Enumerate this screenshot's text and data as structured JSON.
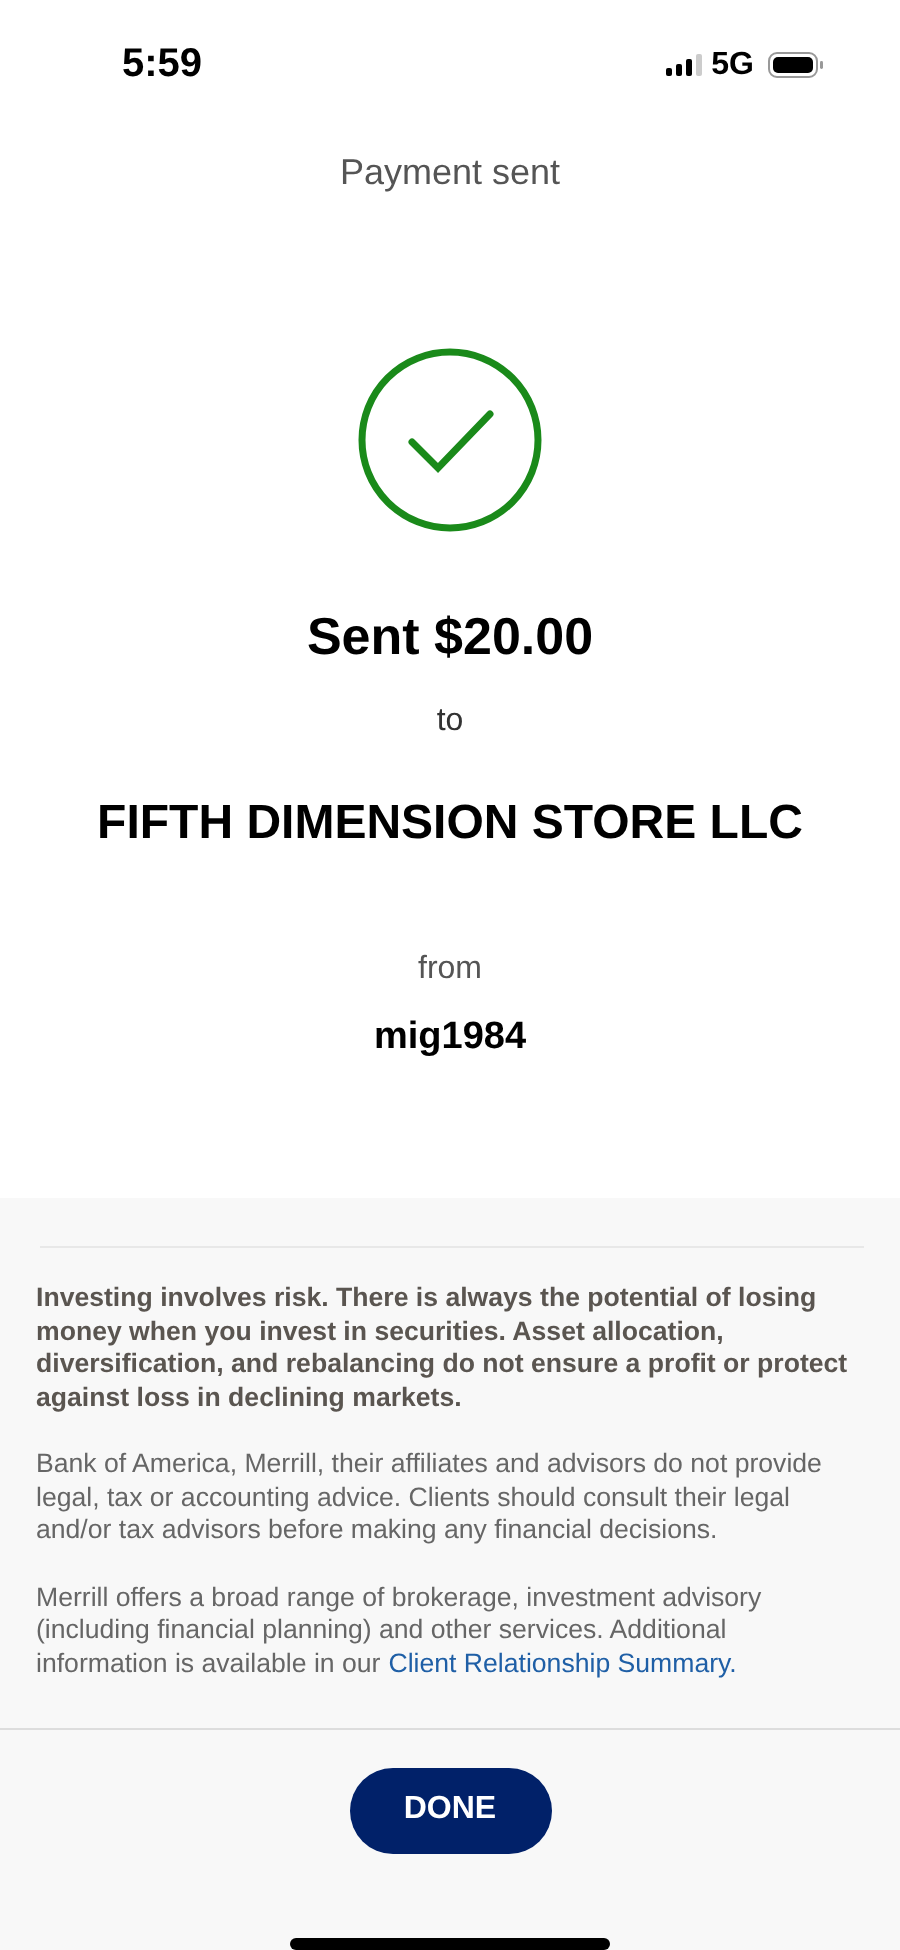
{
  "status_bar": {
    "time": "5:59",
    "network": "5G"
  },
  "header": {
    "title": "Payment sent"
  },
  "confirmation": {
    "amount_line": "Sent $20.00",
    "to_label": "to",
    "recipient": "FIFTH DIMENSION STORE LLC",
    "from_label": "from",
    "sender": "mig1984"
  },
  "disclosures": [
    {
      "kind": "bold",
      "text": "Investing involves risk. There is always the potential of losing money when you invest in securities. Asset allocation, diversification, and rebalancing do not ensure a profit or protect against loss in declining markets."
    },
    {
      "kind": "plain",
      "text": "Bank of America, Merrill, their affiliates and advisors do not provide legal, tax or accounting advice. Clients should consult their legal and/or tax advisors before making any financial decisions."
    },
    {
      "kind": "plain",
      "text": "Merrill offers a broad range of brokerage, investment advisory (including financial planning) and other services. Additional information is available in our",
      "link": "Client Relationship Summary."
    }
  ],
  "done_button": "DONE"
}
